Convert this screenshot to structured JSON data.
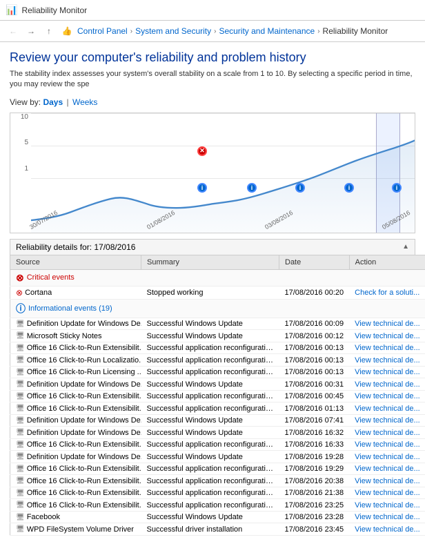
{
  "titleBar": {
    "title": "Reliability Monitor",
    "icon": "📊"
  },
  "navBar": {
    "breadcrumbs": [
      {
        "label": "Control Panel",
        "current": false
      },
      {
        "label": "System and Security",
        "current": false
      },
      {
        "label": "Security and Maintenance",
        "current": false
      },
      {
        "label": "Reliability Monitor",
        "current": true
      }
    ]
  },
  "page": {
    "title": "Review your computer's reliability and problem history",
    "description": "The stability index assesses your system's overall stability on a scale from 1 to 10. By selecting a specific period in time, you may review the spe",
    "viewBy": {
      "label": "View by: ",
      "options": [
        "Days",
        "Weeks"
      ]
    },
    "chart": {
      "yLabels": [
        "10",
        "5",
        "1"
      ],
      "xLabels": [
        "30/07/2016",
        "01/08/2016",
        "03/08/2016",
        "05/08/2016"
      ],
      "highlightDate": "17/08/2016"
    }
  },
  "detailsHeader": {
    "label": "Reliability details for: 17/08/2016"
  },
  "table": {
    "columns": [
      "Source",
      "Summary",
      "Date",
      "Action"
    ],
    "criticalSection": {
      "label": "Critical events"
    },
    "infoSection": {
      "label": "Informational events (19)"
    },
    "rows": [
      {
        "type": "critical-header"
      },
      {
        "source": "Cortana",
        "summary": "Stopped working",
        "date": "17/08/2016 00:20",
        "action": "Check for a soluti...",
        "rowType": "critical"
      },
      {
        "type": "info-header"
      },
      {
        "source": "Definition Update for Windows De...",
        "summary": "Successful Windows Update",
        "date": "17/08/2016 00:09",
        "action": "View technical de...",
        "rowType": "info"
      },
      {
        "source": "Microsoft Sticky Notes",
        "summary": "Successful Windows Update",
        "date": "17/08/2016 00:12",
        "action": "View technical de...",
        "rowType": "info"
      },
      {
        "source": "Office 16 Click-to-Run Extensibilit...",
        "summary": "Successful application reconfiguration",
        "date": "17/08/2016 00:13",
        "action": "View technical de...",
        "rowType": "info"
      },
      {
        "source": "Office 16 Click-to-Run Localizatio...",
        "summary": "Successful application reconfiguration",
        "date": "17/08/2016 00:13",
        "action": "View technical de...",
        "rowType": "info"
      },
      {
        "source": "Office 16 Click-to-Run Licensing ...",
        "summary": "Successful application reconfiguration",
        "date": "17/08/2016 00:13",
        "action": "View technical de...",
        "rowType": "info"
      },
      {
        "source": "Definition Update for Windows De...",
        "summary": "Successful Windows Update",
        "date": "17/08/2016 00:31",
        "action": "View technical de...",
        "rowType": "info"
      },
      {
        "source": "Office 16 Click-to-Run Extensibilit...",
        "summary": "Successful application reconfiguration",
        "date": "17/08/2016 00:45",
        "action": "View technical de...",
        "rowType": "info"
      },
      {
        "source": "Office 16 Click-to-Run Extensibilit...",
        "summary": "Successful application reconfiguration",
        "date": "17/08/2016 01:13",
        "action": "View technical de...",
        "rowType": "info"
      },
      {
        "source": "Definition Update for Windows De...",
        "summary": "Successful Windows Update",
        "date": "17/08/2016 07:41",
        "action": "View technical de...",
        "rowType": "info"
      },
      {
        "source": "Definition Update for Windows De...",
        "summary": "Successful Windows Update",
        "date": "17/08/2016 16:32",
        "action": "View technical de...",
        "rowType": "info"
      },
      {
        "source": "Office 16 Click-to-Run Extensibilit...",
        "summary": "Successful application reconfiguration",
        "date": "17/08/2016 16:33",
        "action": "View technical de...",
        "rowType": "info"
      },
      {
        "source": "Definition Update for Windows De...",
        "summary": "Successful Windows Update",
        "date": "17/08/2016 19:28",
        "action": "View technical de...",
        "rowType": "info"
      },
      {
        "source": "Office 16 Click-to-Run Extensibilit...",
        "summary": "Successful application reconfiguration",
        "date": "17/08/2016 19:29",
        "action": "View technical de...",
        "rowType": "info"
      },
      {
        "source": "Office 16 Click-to-Run Extensibilit...",
        "summary": "Successful application reconfiguration",
        "date": "17/08/2016 20:38",
        "action": "View technical de...",
        "rowType": "info"
      },
      {
        "source": "Office 16 Click-to-Run Extensibilit...",
        "summary": "Successful application reconfiguration",
        "date": "17/08/2016 21:38",
        "action": "View technical de...",
        "rowType": "info"
      },
      {
        "source": "Office 16 Click-to-Run Extensibilit...",
        "summary": "Successful application reconfiguration",
        "date": "17/08/2016 23:25",
        "action": "View technical de...",
        "rowType": "info"
      },
      {
        "source": "Facebook",
        "summary": "Successful Windows Update",
        "date": "17/08/2016 23:28",
        "action": "View technical de...",
        "rowType": "info"
      },
      {
        "source": "WPD FileSystem Volume Driver",
        "summary": "Successful driver installation",
        "date": "17/08/2016 23:45",
        "action": "View technical de...",
        "rowType": "info"
      }
    ]
  }
}
